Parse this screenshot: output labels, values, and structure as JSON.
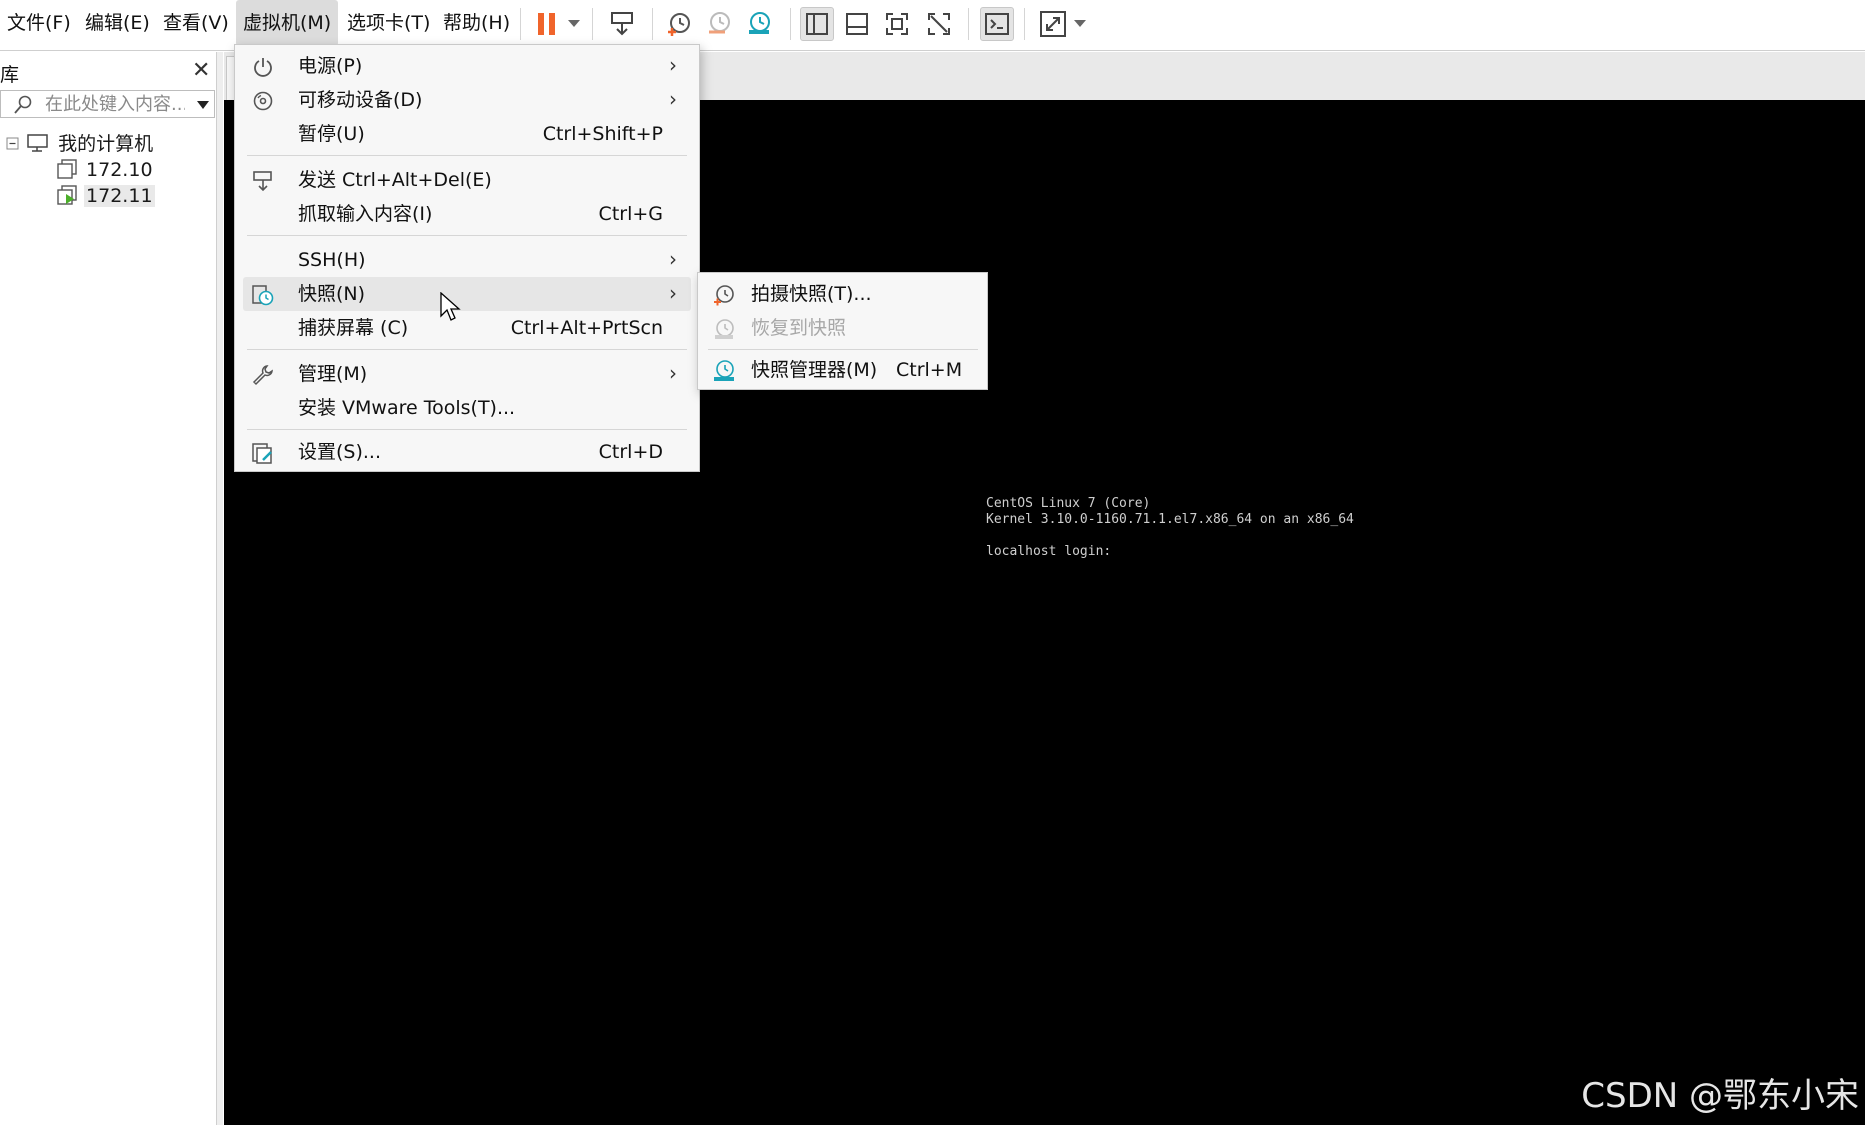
{
  "menubar": {
    "items": [
      {
        "label": "文件(F)"
      },
      {
        "label": "编辑(E)"
      },
      {
        "label": "查看(V)"
      },
      {
        "label": "虚拟机(M)"
      },
      {
        "label": "选项卡(T)"
      },
      {
        "label": "帮助(H)"
      }
    ]
  },
  "toolbar": {
    "icons": [
      "pause-icon",
      "send-keys-icon",
      "take-snapshot-icon",
      "revert-snapshot-icon",
      "snapshot-manager-icon",
      "library-view-icon",
      "thumbnail-bar-icon",
      "fullscreen-icon",
      "unity-icon",
      "console-view-icon",
      "stretch-icon"
    ]
  },
  "library": {
    "title": "库",
    "search_placeholder": "在此处键入内容...",
    "tree": {
      "root": "我的计算机",
      "vms": [
        {
          "label": "172.10",
          "running": false
        },
        {
          "label": "172.11",
          "running": true
        }
      ]
    }
  },
  "vm_menu": {
    "items": [
      {
        "label": "电源(P)",
        "shortcut": "",
        "submenu": true
      },
      {
        "label": "可移动设备(D)",
        "shortcut": "",
        "submenu": true
      },
      {
        "label": "暂停(U)",
        "shortcut": "Ctrl+Shift+P",
        "submenu": false
      },
      {
        "label": "发送 Ctrl+Alt+Del(E)",
        "shortcut": "",
        "submenu": false
      },
      {
        "label": "抓取输入内容(I)",
        "shortcut": "Ctrl+G",
        "submenu": false
      },
      {
        "label": "SSH(H)",
        "shortcut": "",
        "submenu": true
      },
      {
        "label": "快照(N)",
        "shortcut": "",
        "submenu": true
      },
      {
        "label": "捕获屏幕 (C)",
        "shortcut": "Ctrl+Alt+PrtScn",
        "submenu": false
      },
      {
        "label": "管理(M)",
        "shortcut": "",
        "submenu": true
      },
      {
        "label": "安装 VMware Tools(T)...",
        "shortcut": "",
        "submenu": false
      },
      {
        "label": "设置(S)...",
        "shortcut": "Ctrl+D",
        "submenu": false
      }
    ]
  },
  "snapshot_submenu": {
    "items": [
      {
        "label": "拍摄快照(T)...",
        "shortcut": "",
        "enabled": true
      },
      {
        "label": "恢复到快照",
        "shortcut": "",
        "enabled": false
      },
      {
        "label": "快照管理器(M)",
        "shortcut": "Ctrl+M",
        "enabled": true
      }
    ]
  },
  "console": {
    "lines": "CentOS Linux 7 (Core)\nKernel 3.10.0-1160.71.1.el7.x86_64 on an x86_64\n\nlocalhost login:"
  },
  "watermark": "CSDN @鄂东小宋",
  "colors": {
    "pause_orange": "#f0642b",
    "snapshot_teal": "#1aa3b8",
    "running_green": "#4caf2a",
    "console_bg": "#000000"
  }
}
